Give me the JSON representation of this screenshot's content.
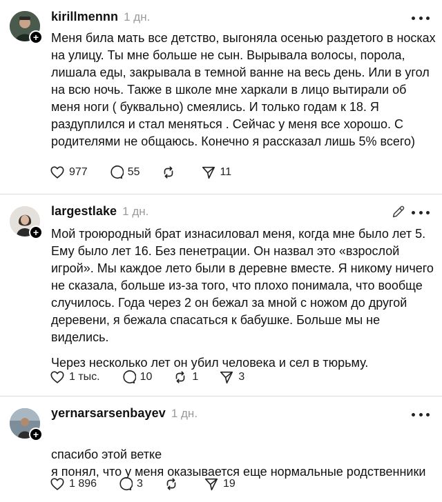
{
  "posts": [
    {
      "username": "kirillmennn",
      "time": "1 дн.",
      "paragraphs": [
        "Меня била мать все детство, выгоняла осенью раздетого в носках на улицу. Ты мне больше не сын. Вырывала волосы, порола, лишала еды, закрывала в темной ванне на весь день. Или в угол на всю ночь. Также в школе мне харкали в лицо вытирали об меня ноги ( буквально) смеялись. И только годам к 18. Я раздуплился и стал меняться . Сейчас у меня все хорошо. С родителями не общаюсь. Конечно я рассказал лишь 5% всего)"
      ],
      "likes": "977",
      "replies": "55",
      "reposts": "",
      "shares": "11",
      "avatar_bg": "#3b4a3f"
    },
    {
      "username": "largestlake",
      "time": "1 дн.",
      "paragraphs": [
        "Мой троюродный брат изнасиловал меня, когда мне было лет 5. Ему было лет 16. Без пенетрации. Он назвал это «взрослой игрой». Мы каждое лето были в деревне вместе. Я никому ничего не сказала, больше из-за того, что плохо понимала, что вообще случилось. Года через 2 он бежал за мной с ножом до другой деревени, я бежала спасаться к бабушке. Больше мы не виделись.",
        "Через несколько лет он убил человека и сел в тюрьму."
      ],
      "likes": "1 тыс.",
      "replies": "10",
      "reposts": "1",
      "shares": "3",
      "avatar_bg": "#d8d4cf"
    },
    {
      "username": "yernarsarsenbayev",
      "time": "1 дн.",
      "paragraphs": [
        "спасибо этой ветке\nя понял, что у меня оказывается еще нормальные родственники"
      ],
      "likes": "1 896",
      "replies": "3",
      "reposts": "",
      "shares": "19",
      "avatar_bg": "#5a6b7a"
    }
  ],
  "icons": {
    "like": "heart-icon",
    "reply": "comment-icon",
    "repost": "repost-icon",
    "share": "share-icon",
    "more": "more-icon",
    "edit": "pencil-icon",
    "follow": "plus-icon"
  },
  "colors": {
    "text": "#111111",
    "muted": "#9a9a9a",
    "divider": "#d9d9d9"
  }
}
